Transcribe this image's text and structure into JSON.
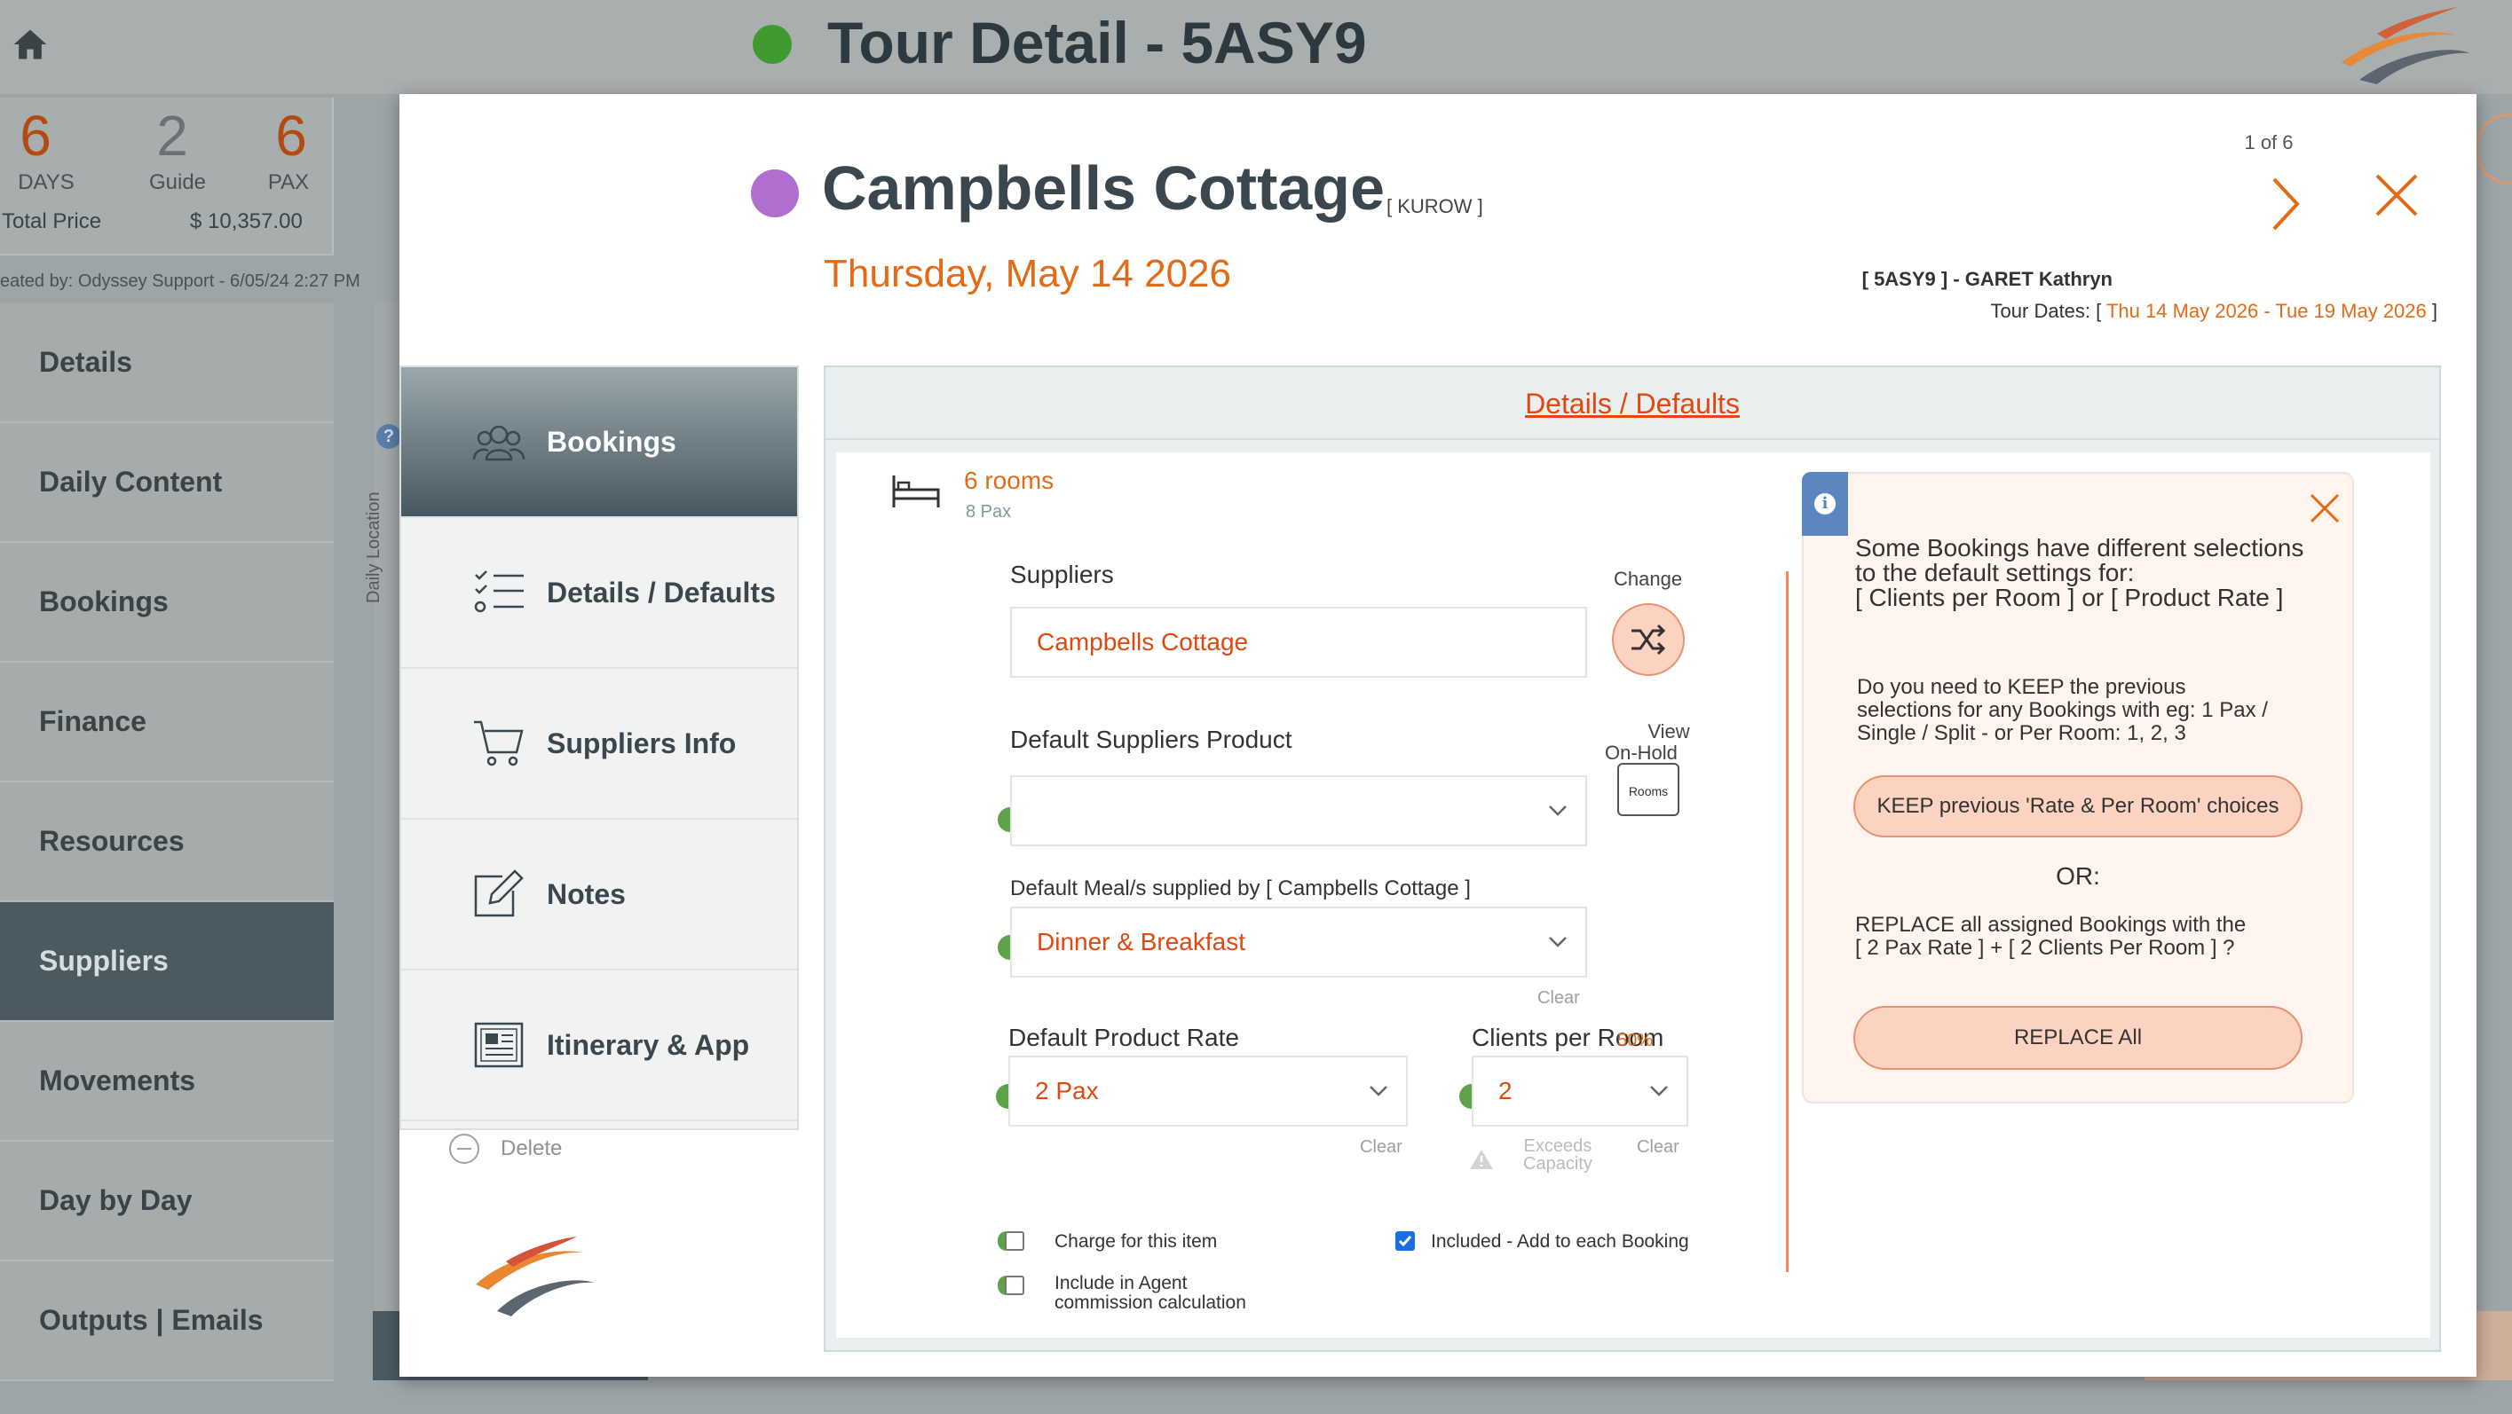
{
  "app": {
    "title": "Tour Detail - 5ASY9",
    "status_color": "#3f9a2f",
    "summary": {
      "days_value": "6",
      "days_label": "DAYS",
      "guide_value": "2",
      "guide_label": "Guide",
      "pax_value": "6",
      "pax_label": "PAX",
      "total_price_label": "Total Price",
      "total_price_value": "$ 10,357.00"
    },
    "created_by": "eated by: Odyssey Support - 6/05/24 2:27 PM",
    "nav": [
      {
        "label": "Details"
      },
      {
        "label": "Daily Content"
      },
      {
        "label": "Bookings"
      },
      {
        "label": "Finance"
      },
      {
        "label": "Resources"
      },
      {
        "label": "Suppliers"
      },
      {
        "label": "Movements"
      },
      {
        "label": "Day by Day"
      },
      {
        "label": "Outputs | Emails"
      }
    ],
    "active_nav": "Suppliers",
    "vertical_label": "Daily Location",
    "help_icon": "?"
  },
  "modal": {
    "title": "Campbells Cottage",
    "code": "[ KUROW ]",
    "date": "Thursday, May 14 2026",
    "pager": "1 of 6",
    "tour_ref": "[ 5ASY9 ] - GARET Kathryn",
    "tour_dates_prefix": "Tour Dates: [",
    "tour_dates_start": "Thu 14 May 2026",
    "tour_dates_sep": " - ",
    "tour_dates_end": "Tue 19 May 2026",
    "tour_dates_suffix": " ]",
    "dot_color": "#b06fcf",
    "tabs": [
      {
        "label": "Bookings",
        "icon": "people-icon"
      },
      {
        "label": "Details / Defaults",
        "icon": "checklist-icon"
      },
      {
        "label": "Suppliers Info",
        "icon": "cart-icon"
      },
      {
        "label": "Notes",
        "icon": "edit-icon"
      },
      {
        "label": "Itinerary & App",
        "icon": "document-icon"
      }
    ],
    "delete_label": "Delete",
    "panel": {
      "heading": "Details / Defaults",
      "rooms": "6 rooms",
      "pax": "8 Pax",
      "suppliers_label": "Suppliers",
      "suppliers_value": "Campbells Cottage",
      "change_label": "Change",
      "view_onhold_label_1": "View",
      "view_onhold_label_2": "On-Hold",
      "onhold_icon_text": "Rooms",
      "default_product_label": "Default Suppliers Product",
      "default_product_value": "",
      "default_meals_label": "Default Meal/s supplied by [ Campbells Cottage ]",
      "default_meals_value": "Dinner & Breakfast",
      "clear_label": "Clear",
      "default_rate_label": "Default Product Rate",
      "default_rate_value": "2 Pax",
      "clients_per_room_label": "Clients per Room",
      "clients_percent": "50%",
      "clients_per_room_value": "2",
      "exceeds_capacity_1": "Exceeds",
      "exceeds_capacity_2": "Capacity",
      "charge_label": "Charge for this item",
      "charge_checked": false,
      "agent_commission_label_1": "Include in Agent",
      "agent_commission_label_2": "commission calculation",
      "agent_commission_checked": false,
      "included_label": "Included - Add to each Booking",
      "included_checked": true
    },
    "info": {
      "line1": "Some Bookings have different selections",
      "line2": "to the default settings for:",
      "line3": "[ Clients per Room ] or [ Product Rate ]",
      "q1": "Do you need to KEEP the previous",
      "q2": "selections for any Bookings with eg: 1 Pax /",
      "q3": "Single / Split  - or Per Room: 1, 2, 3",
      "keep_button": "KEEP previous 'Rate & Per Room' choices",
      "or": "OR:",
      "r1": "REPLACE all assigned Bookings with the",
      "r2": "[ 2 Pax Rate ] + [ 2 Clients Per Room ] ?",
      "replace_button": "REPLACE All"
    }
  }
}
